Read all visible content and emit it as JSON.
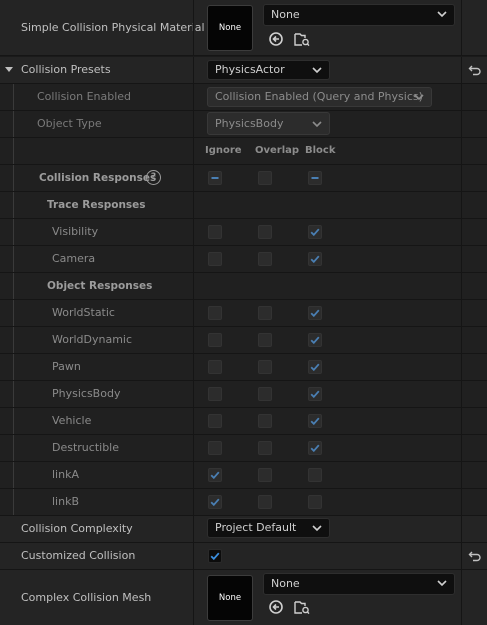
{
  "physical_material": {
    "label": "Simple Collision Physical Material",
    "thumb_text": "None",
    "value": "None"
  },
  "collision_presets": {
    "label": "Collision Presets",
    "value": "PhysicsActor"
  },
  "collision_enabled": {
    "label": "Collision Enabled",
    "value": "Collision Enabled (Query and Physics)"
  },
  "object_type": {
    "label": "Object Type",
    "value": "PhysicsBody"
  },
  "headers": {
    "ignore": "Ignore",
    "overlap": "Overlap",
    "block": "Block"
  },
  "collision_responses": {
    "label": "Collision Responses",
    "help": "?"
  },
  "trace_responses": {
    "label": "Trace Responses",
    "items": [
      {
        "label": "Visibility",
        "ignore": false,
        "overlap": false,
        "block": true,
        "enabled": false
      },
      {
        "label": "Camera",
        "ignore": false,
        "overlap": false,
        "block": true,
        "enabled": false
      }
    ]
  },
  "object_responses": {
    "label": "Object Responses",
    "items": [
      {
        "label": "WorldStatic",
        "ignore": false,
        "overlap": false,
        "block": true,
        "enabled": false
      },
      {
        "label": "WorldDynamic",
        "ignore": false,
        "overlap": false,
        "block": true,
        "enabled": false
      },
      {
        "label": "Pawn",
        "ignore": false,
        "overlap": false,
        "block": true,
        "enabled": false
      },
      {
        "label": "PhysicsBody",
        "ignore": false,
        "overlap": false,
        "block": true,
        "enabled": false
      },
      {
        "label": "Vehicle",
        "ignore": false,
        "overlap": false,
        "block": true,
        "enabled": false
      },
      {
        "label": "Destructible",
        "ignore": false,
        "overlap": false,
        "block": true,
        "enabled": false
      },
      {
        "label": "linkA",
        "ignore": true,
        "overlap": false,
        "block": false,
        "enabled": false
      },
      {
        "label": "linkB",
        "ignore": true,
        "overlap": false,
        "block": false,
        "enabled": false
      }
    ]
  },
  "collision_complexity": {
    "label": "Collision Complexity",
    "value": "Project Default"
  },
  "customized_collision": {
    "label": "Customized Collision",
    "checked": true
  },
  "complex_collision_mesh": {
    "label": "Complex Collision Mesh",
    "thumb_text": "None",
    "value": "None"
  },
  "colors": {
    "check_enabled": "#3b8fe0",
    "check_disabled": "#4a7fb3",
    "background": "#242424"
  }
}
